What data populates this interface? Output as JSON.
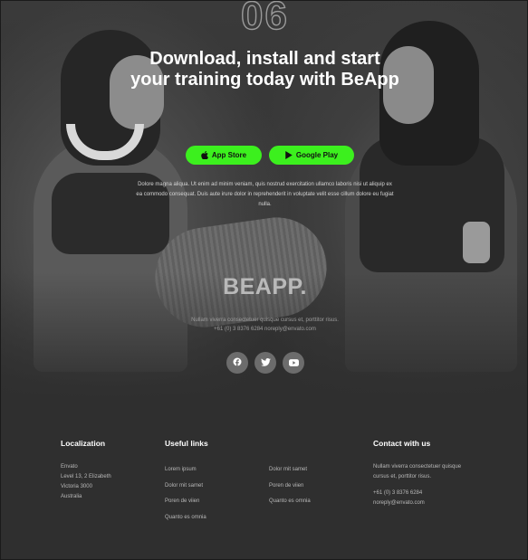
{
  "hero": {
    "step_number": "06",
    "headline": "Download, install and start your training today with BeApp",
    "app_store_label": "App Store",
    "google_play_label": "Google Play",
    "lead": "Dolore magna aliqua. Ut enim ad minim veniam, quis nostrud exercitation ullamco laboris nisi ut aliquip ex ea commodo consequat. Duis aute irure dolor in reprehenderit in voluptate velit esse cillum dolore eu fugiat nulla."
  },
  "brand": {
    "logo": "BEAPP.",
    "tagline": "Nullam viverra consectetuer quisque cursus et, porttitor risus.",
    "contact": "+61 (0) 3 8376 6284 noreply@envato.com"
  },
  "social": [
    "facebook-icon",
    "twitter-icon",
    "youtube-icon"
  ],
  "footer": {
    "localization": {
      "title": "Localization",
      "lines": [
        "Envato",
        "Level 13, 2 Elizabeth",
        "Victoria 3000",
        "Australia"
      ]
    },
    "useful_links": {
      "title": "Useful links",
      "col_a": [
        "Lorem ipsum",
        "Dolor mit samet",
        "Poren de viien",
        "Quanto es omnia"
      ],
      "col_b": [
        "Dolor mit samet",
        "Poren de viien",
        "Quanto es omnia"
      ]
    },
    "contact": {
      "title": "Contact with us",
      "description": "Nullam viverra consectetuer quisque cursus et, porttitor risus.",
      "phone": "+61 (0) 3 8376 6284",
      "email": "noreply@envato.com"
    }
  },
  "colors": {
    "accent": "#3cf01e",
    "background": "#2f2f2f"
  }
}
